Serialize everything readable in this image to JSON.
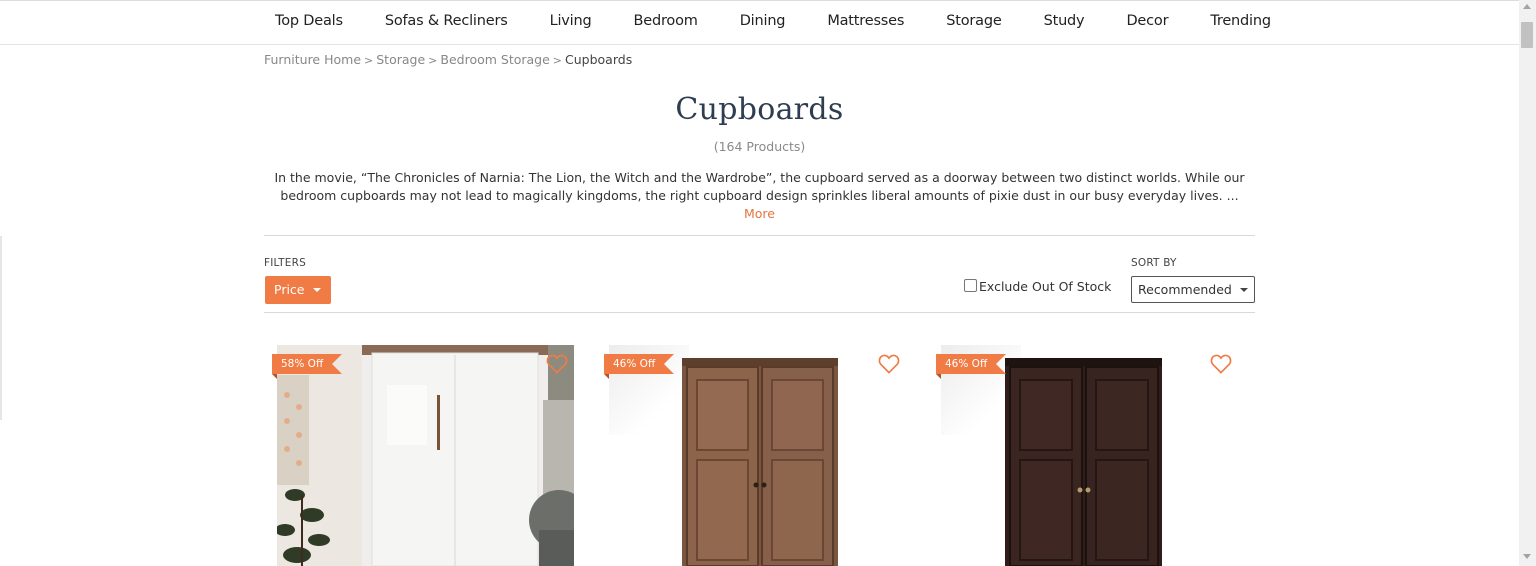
{
  "nav": {
    "items": [
      "Top Deals",
      "Sofas & Recliners",
      "Living",
      "Bedroom",
      "Dining",
      "Mattresses",
      "Storage",
      "Study",
      "Decor",
      "Trending"
    ]
  },
  "breadcrumb": {
    "items": [
      "Furniture Home",
      "Storage",
      "Bedroom Storage"
    ],
    "current": "Cupboards",
    "separator": ">"
  },
  "page": {
    "title": "Cupboards",
    "product_count": "(164 Products)",
    "description": "In the movie, “The Chronicles of Narnia: The Lion, the Witch and the Wardrobe”, the cupboard served as a doorway between two distinct worlds. While our bedroom cupboards may not lead to magically kingdoms, the right cupboard design sprinkles liberal amounts of pixie dust in our busy everyday lives. ...",
    "more_label": "More"
  },
  "filters": {
    "label": "FILTERS",
    "price_label": "Price",
    "exclude_label": "Exclude Out Of Stock",
    "exclude_checked": false
  },
  "sort": {
    "label": "SORT BY",
    "selected": "Recommended"
  },
  "products": [
    {
      "discount": "58% Off",
      "image": "white-glossy-wardrobe",
      "wishlist_icon": "heart-outline-icon"
    },
    {
      "discount": "46% Off",
      "image": "walnut-wooden-wardrobe",
      "wishlist_icon": "heart-outline-icon"
    },
    {
      "discount": "46% Off",
      "image": "dark-mahogany-wardrobe",
      "wishlist_icon": "heart-outline-icon"
    }
  ],
  "colors": {
    "accent": "#f07b45",
    "title": "#2e3e50",
    "link": "#e4743f"
  }
}
